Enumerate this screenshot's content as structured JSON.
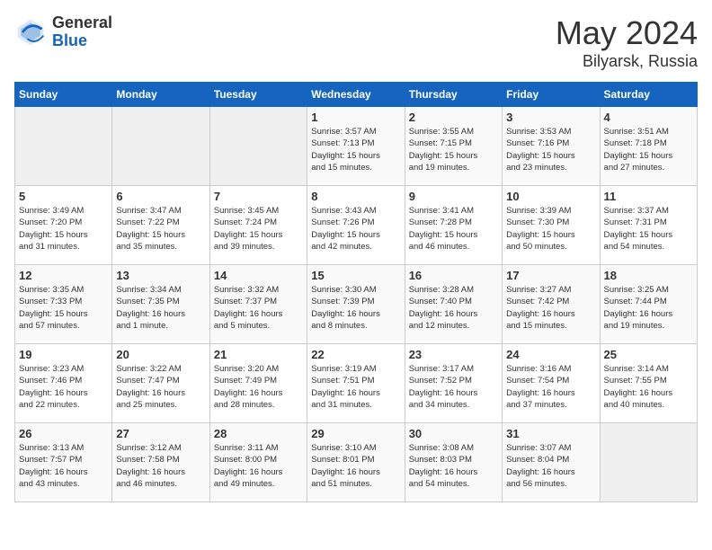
{
  "header": {
    "logo_general": "General",
    "logo_blue": "Blue",
    "title": "May 2024",
    "subtitle": "Bilyarsk, Russia"
  },
  "days_of_week": [
    "Sunday",
    "Monday",
    "Tuesday",
    "Wednesday",
    "Thursday",
    "Friday",
    "Saturday"
  ],
  "weeks": [
    [
      {
        "day": "",
        "info": ""
      },
      {
        "day": "",
        "info": ""
      },
      {
        "day": "",
        "info": ""
      },
      {
        "day": "1",
        "info": "Sunrise: 3:57 AM\nSunset: 7:13 PM\nDaylight: 15 hours\nand 15 minutes."
      },
      {
        "day": "2",
        "info": "Sunrise: 3:55 AM\nSunset: 7:15 PM\nDaylight: 15 hours\nand 19 minutes."
      },
      {
        "day": "3",
        "info": "Sunrise: 3:53 AM\nSunset: 7:16 PM\nDaylight: 15 hours\nand 23 minutes."
      },
      {
        "day": "4",
        "info": "Sunrise: 3:51 AM\nSunset: 7:18 PM\nDaylight: 15 hours\nand 27 minutes."
      }
    ],
    [
      {
        "day": "5",
        "info": "Sunrise: 3:49 AM\nSunset: 7:20 PM\nDaylight: 15 hours\nand 31 minutes."
      },
      {
        "day": "6",
        "info": "Sunrise: 3:47 AM\nSunset: 7:22 PM\nDaylight: 15 hours\nand 35 minutes."
      },
      {
        "day": "7",
        "info": "Sunrise: 3:45 AM\nSunset: 7:24 PM\nDaylight: 15 hours\nand 39 minutes."
      },
      {
        "day": "8",
        "info": "Sunrise: 3:43 AM\nSunset: 7:26 PM\nDaylight: 15 hours\nand 42 minutes."
      },
      {
        "day": "9",
        "info": "Sunrise: 3:41 AM\nSunset: 7:28 PM\nDaylight: 15 hours\nand 46 minutes."
      },
      {
        "day": "10",
        "info": "Sunrise: 3:39 AM\nSunset: 7:30 PM\nDaylight: 15 hours\nand 50 minutes."
      },
      {
        "day": "11",
        "info": "Sunrise: 3:37 AM\nSunset: 7:31 PM\nDaylight: 15 hours\nand 54 minutes."
      }
    ],
    [
      {
        "day": "12",
        "info": "Sunrise: 3:35 AM\nSunset: 7:33 PM\nDaylight: 15 hours\nand 57 minutes."
      },
      {
        "day": "13",
        "info": "Sunrise: 3:34 AM\nSunset: 7:35 PM\nDaylight: 16 hours\nand 1 minute."
      },
      {
        "day": "14",
        "info": "Sunrise: 3:32 AM\nSunset: 7:37 PM\nDaylight: 16 hours\nand 5 minutes."
      },
      {
        "day": "15",
        "info": "Sunrise: 3:30 AM\nSunset: 7:39 PM\nDaylight: 16 hours\nand 8 minutes."
      },
      {
        "day": "16",
        "info": "Sunrise: 3:28 AM\nSunset: 7:40 PM\nDaylight: 16 hours\nand 12 minutes."
      },
      {
        "day": "17",
        "info": "Sunrise: 3:27 AM\nSunset: 7:42 PM\nDaylight: 16 hours\nand 15 minutes."
      },
      {
        "day": "18",
        "info": "Sunrise: 3:25 AM\nSunset: 7:44 PM\nDaylight: 16 hours\nand 19 minutes."
      }
    ],
    [
      {
        "day": "19",
        "info": "Sunrise: 3:23 AM\nSunset: 7:46 PM\nDaylight: 16 hours\nand 22 minutes."
      },
      {
        "day": "20",
        "info": "Sunrise: 3:22 AM\nSunset: 7:47 PM\nDaylight: 16 hours\nand 25 minutes."
      },
      {
        "day": "21",
        "info": "Sunrise: 3:20 AM\nSunset: 7:49 PM\nDaylight: 16 hours\nand 28 minutes."
      },
      {
        "day": "22",
        "info": "Sunrise: 3:19 AM\nSunset: 7:51 PM\nDaylight: 16 hours\nand 31 minutes."
      },
      {
        "day": "23",
        "info": "Sunrise: 3:17 AM\nSunset: 7:52 PM\nDaylight: 16 hours\nand 34 minutes."
      },
      {
        "day": "24",
        "info": "Sunrise: 3:16 AM\nSunset: 7:54 PM\nDaylight: 16 hours\nand 37 minutes."
      },
      {
        "day": "25",
        "info": "Sunrise: 3:14 AM\nSunset: 7:55 PM\nDaylight: 16 hours\nand 40 minutes."
      }
    ],
    [
      {
        "day": "26",
        "info": "Sunrise: 3:13 AM\nSunset: 7:57 PM\nDaylight: 16 hours\nand 43 minutes."
      },
      {
        "day": "27",
        "info": "Sunrise: 3:12 AM\nSunset: 7:58 PM\nDaylight: 16 hours\nand 46 minutes."
      },
      {
        "day": "28",
        "info": "Sunrise: 3:11 AM\nSunset: 8:00 PM\nDaylight: 16 hours\nand 49 minutes."
      },
      {
        "day": "29",
        "info": "Sunrise: 3:10 AM\nSunset: 8:01 PM\nDaylight: 16 hours\nand 51 minutes."
      },
      {
        "day": "30",
        "info": "Sunrise: 3:08 AM\nSunset: 8:03 PM\nDaylight: 16 hours\nand 54 minutes."
      },
      {
        "day": "31",
        "info": "Sunrise: 3:07 AM\nSunset: 8:04 PM\nDaylight: 16 hours\nand 56 minutes."
      },
      {
        "day": "",
        "info": ""
      }
    ]
  ]
}
